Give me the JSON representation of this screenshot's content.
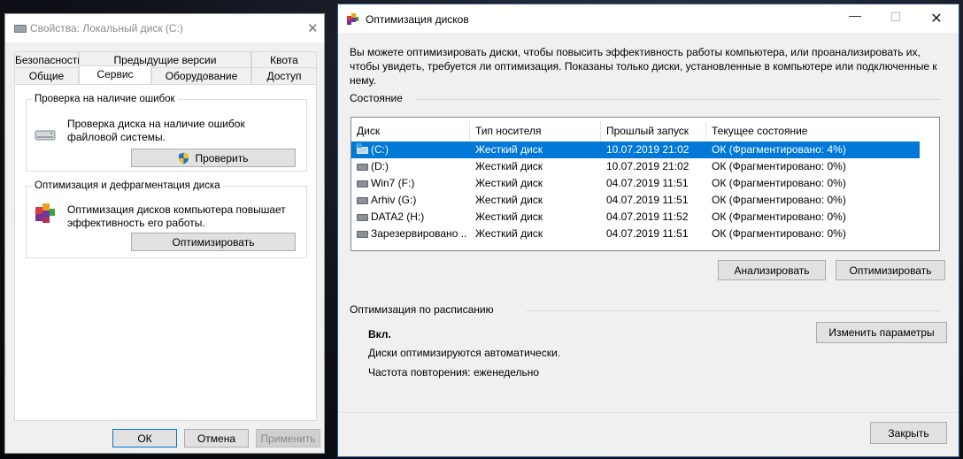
{
  "props": {
    "title": "Свойства: Локальный диск (C:)",
    "tabs_top": [
      "Безопасность",
      "Предыдущие версии",
      "Квота"
    ],
    "tabs_bottom": [
      "Общие",
      "Сервис",
      "Оборудование",
      "Доступ"
    ],
    "active_tab": "Сервис",
    "check_group": {
      "legend": "Проверка на наличие ошибок",
      "description": "Проверка диска на наличие ошибок файловой системы.",
      "button": "Проверить"
    },
    "optimize_group": {
      "legend": "Оптимизация и дефрагментация диска",
      "description": "Оптимизация дисков компьютера повышает эффективность его работы.",
      "button": "Оптимизировать"
    },
    "ok_button": "ОК",
    "cancel_button": "Отмена",
    "apply_button": "Применить"
  },
  "opt": {
    "title": "Оптимизация дисков",
    "intro": "Вы можете оптимизировать диски, чтобы повысить эффективность работы  компьютера, или проанализировать их, чтобы увидеть, требуется ли оптимизация. Показаны только диски, установленные в компьютере или подключенные к нему.",
    "status_label": "Состояние",
    "columns": [
      "Диск",
      "Тип носителя",
      "Прошлый запуск",
      "Текущее состояние"
    ],
    "drives": [
      {
        "name": "(C:)",
        "type": "Жесткий диск",
        "last": "10.07.2019 21:02",
        "state": "ОК (Фрагментировано: 4%)"
      },
      {
        "name": "(D:)",
        "type": "Жесткий диск",
        "last": "10.07.2019 21:02",
        "state": "ОК (Фрагментировано: 0%)"
      },
      {
        "name": "Win7 (F:)",
        "type": "Жесткий диск",
        "last": "04.07.2019 11:51",
        "state": "ОК (Фрагментировано: 0%)"
      },
      {
        "name": "Arhiv (G:)",
        "type": "Жесткий диск",
        "last": "04.07.2019 11:51",
        "state": "ОК (Фрагментировано: 0%)"
      },
      {
        "name": "DATA2 (H:)",
        "type": "Жесткий диск",
        "last": "04.07.2019 11:52",
        "state": "ОК (Фрагментировано: 0%)"
      },
      {
        "name": "Зарезервировано ...",
        "type": "Жесткий диск",
        "last": "04.07.2019 11:51",
        "state": "ОК (Фрагментировано: 0%)"
      }
    ],
    "selected_drive": "(C:)",
    "analyze_button": "Анализировать",
    "optimize_button": "Оптимизировать",
    "schedule_label": "Оптимизация по расписанию",
    "schedule_state": "Вкл.",
    "schedule_desc": "Диски оптимизируются автоматически.",
    "frequency": "Частота повторения: еженедельно",
    "change_button": "Изменить параметры",
    "close_button": "Закрыть"
  },
  "colors": {
    "selection": "#0078d7",
    "accent_border": "#2b5aa0"
  },
  "icons": [
    "drive-icon",
    "shield-uac-icon",
    "defrag-icon",
    "close-icon",
    "minimize-icon",
    "maximize-icon",
    "system-drive-icon"
  ]
}
